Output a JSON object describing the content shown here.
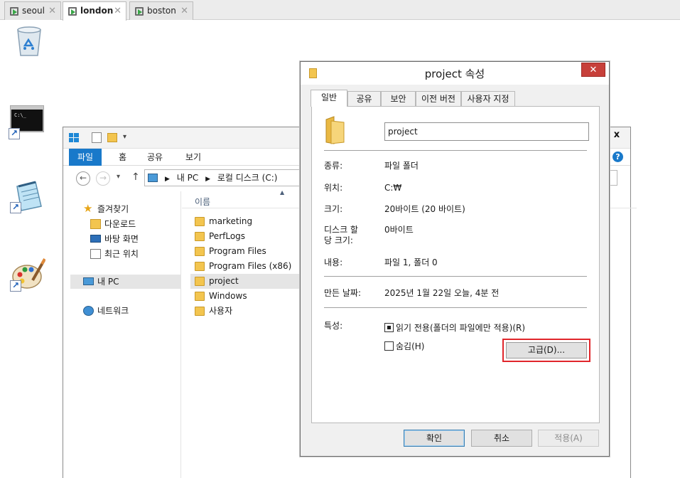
{
  "vm_tabs": [
    {
      "label": "seoul",
      "active": false
    },
    {
      "label": "london",
      "active": true
    },
    {
      "label": "boston",
      "active": false
    }
  ],
  "vm_tab_close_glyph": "✕",
  "desktop_icons": [
    "recycle-bin-icon",
    "command-prompt-icon",
    "notepad-icon",
    "paint-icon"
  ],
  "explorer": {
    "ribbon_tabs": [
      "파일",
      "홈",
      "공유",
      "보기"
    ],
    "breadcrumb": [
      "내 PC",
      "로컬 디스크 (C:)"
    ],
    "nav": {
      "favorites": "즐겨찾기",
      "downloads": "다운로드",
      "desktop": "바탕 화면",
      "recent": "최근 위치",
      "this_pc": "내 PC",
      "network": "네트워크"
    },
    "column_name": "이름",
    "files": [
      "marketing",
      "PerfLogs",
      "Program Files",
      "Program Files (x86)",
      "project",
      "Windows",
      "사용자"
    ],
    "selected_file": "project"
  },
  "dialog": {
    "title": "project 속성",
    "tabs": [
      "일반",
      "공유",
      "보안",
      "이전 버전",
      "사용자 지정"
    ],
    "active_tab": "일반",
    "folder_name": "project",
    "labels": {
      "type": "종류:",
      "location": "위치:",
      "size": "크기:",
      "size_on_disk_1": "디스크 할",
      "size_on_disk_2": "당 크기:",
      "contains": "내용:",
      "created": "만든 날짜:",
      "attributes": "특성:"
    },
    "values": {
      "type": "파일 폴더",
      "location": "C:₩",
      "size": "20바이트 (20 바이트)",
      "size_on_disk": "0바이트",
      "contains": "파일 1, 폴더 0",
      "created": "2025년 1월 22일 오늘, 4분 전"
    },
    "attributes": {
      "readonly_label": "읽기 전용(폴더의 파일에만 적용)(R)",
      "readonly_state": "indeterminate",
      "hidden_label": "숨김(H)",
      "hidden_checked": false
    },
    "advanced_button": "고급(D)...",
    "buttons": {
      "ok": "확인",
      "cancel": "취소",
      "apply": "적용(A)"
    },
    "close_glyph": "✕",
    "colors": {
      "close_button": "#c7403a",
      "highlight_box": "#e0262b",
      "ribbon_file_tab": "#1979ca"
    }
  }
}
